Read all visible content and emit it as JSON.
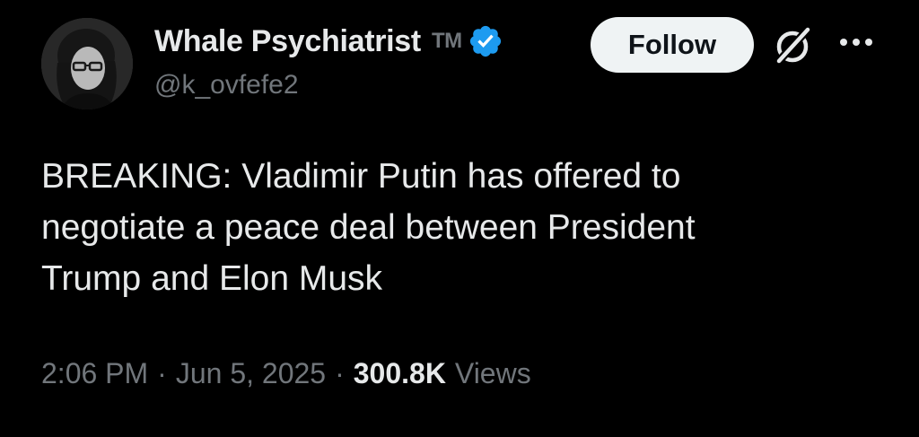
{
  "author": {
    "display_name": "Whale Psychiatrist",
    "tm_badge": "TM",
    "handle": "@k_ovfefe2",
    "verified": true,
    "verified_color": "#1d9bf0"
  },
  "actions": {
    "follow_label": "Follow"
  },
  "tweet": {
    "lines": [
      "BREAKING: Vladimir Putin has offered to",
      "negotiate a peace deal between President",
      "Trump and Elon Musk"
    ]
  },
  "meta": {
    "time": "2:06 PM",
    "separator": "·",
    "date": "Jun 5, 2025",
    "views_count": "300.8K",
    "views_label": "Views"
  },
  "icons": {
    "verified": "verified-badge-icon",
    "grok": "grok-icon",
    "more": "more-options-icon"
  },
  "colors": {
    "background": "#000000",
    "primary_text": "#e7e9ea",
    "secondary_text": "#71767b",
    "follow_button_bg": "#eff3f4"
  }
}
